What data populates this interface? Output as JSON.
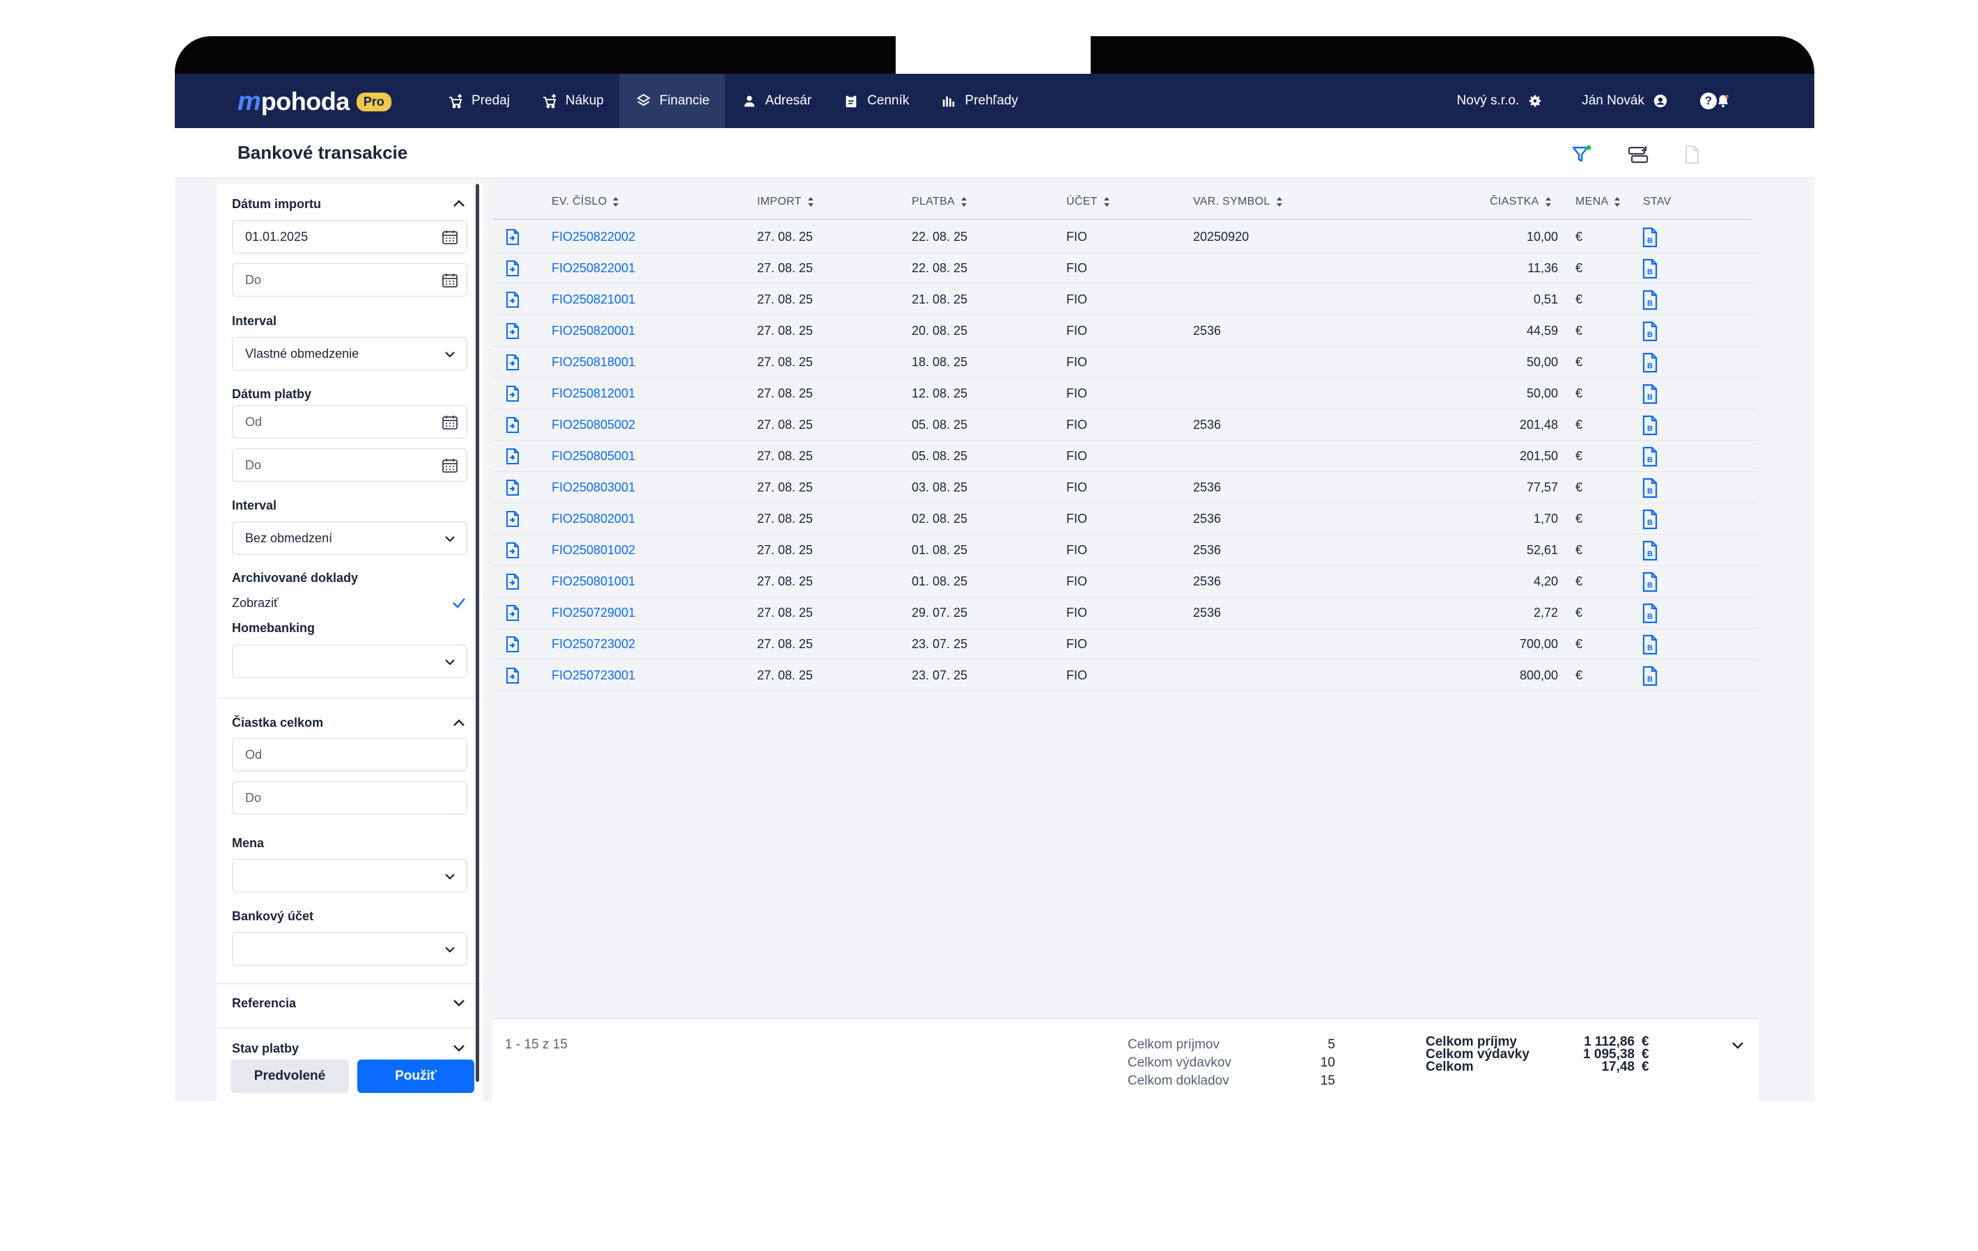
{
  "app": {
    "logo_text": "pohoda",
    "logo_badge": "Pro",
    "nav": [
      {
        "label": "Predaj",
        "icon": "cart-plus-icon"
      },
      {
        "label": "Nákup",
        "icon": "cart-plus-icon"
      },
      {
        "label": "Financie",
        "icon": "coins-icon",
        "active": true
      },
      {
        "label": "Adresár",
        "icon": "person-icon"
      },
      {
        "label": "Cenník",
        "icon": "clipboard-icon"
      },
      {
        "label": "Prehľady",
        "icon": "bar-chart-icon"
      }
    ],
    "company": "Nový s.r.o.",
    "user": "Ján Novák",
    "help_label": "?"
  },
  "page": {
    "title": "Bankové transakcie"
  },
  "filters": {
    "datum_importu": {
      "label": "Dátum importu",
      "from_value": "01.01.2025",
      "to_placeholder": "Do"
    },
    "interval1": {
      "label": "Interval",
      "value": "Vlastné obmedzenie"
    },
    "datum_platby": {
      "label": "Dátum platby",
      "from_placeholder": "Od",
      "to_placeholder": "Do"
    },
    "interval2": {
      "label": "Interval",
      "value": "Bez obmedzení"
    },
    "archivovane": {
      "label": "Archivované doklady",
      "option": "Zobraziť",
      "checked": true
    },
    "homebanking": {
      "label": "Homebanking",
      "value": ""
    },
    "ciastka": {
      "label": "Čiastka celkom",
      "from_placeholder": "Od",
      "to_placeholder": "Do"
    },
    "mena": {
      "label": "Mena",
      "value": ""
    },
    "bankovy_ucet": {
      "label": "Bankový účet",
      "value": ""
    },
    "referencia": {
      "label": "Referencia"
    },
    "stav_platby": {
      "label": "Stav platby"
    },
    "btn_default": "Predvolené",
    "btn_apply": "Použiť"
  },
  "table": {
    "columns": {
      "ev_cislo": "EV. ČÍSLO",
      "import": "IMPORT",
      "platba": "PLATBA",
      "ucet": "ÚČET",
      "var_symbol": "VAR. SYMBOL",
      "ciastka": "ČIASTKA",
      "mena": "MENA",
      "stav": "STAV"
    },
    "rows": [
      {
        "ev": "FIO250822002",
        "import": "27. 08. 25",
        "platba": "22. 08. 25",
        "ucet": "FIO",
        "vs": "20250920",
        "ciastka": "10,00",
        "mena": "€"
      },
      {
        "ev": "FIO250822001",
        "import": "27. 08. 25",
        "platba": "22. 08. 25",
        "ucet": "FIO",
        "vs": "",
        "ciastka": "11,36",
        "mena": "€"
      },
      {
        "ev": "FIO250821001",
        "import": "27. 08. 25",
        "platba": "21. 08. 25",
        "ucet": "FIO",
        "vs": "",
        "ciastka": "0,51",
        "mena": "€"
      },
      {
        "ev": "FIO250820001",
        "import": "27. 08. 25",
        "platba": "20. 08. 25",
        "ucet": "FIO",
        "vs": "2536",
        "ciastka": "44,59",
        "mena": "€"
      },
      {
        "ev": "FIO250818001",
        "import": "27. 08. 25",
        "platba": "18. 08. 25",
        "ucet": "FIO",
        "vs": "",
        "ciastka": "50,00",
        "mena": "€"
      },
      {
        "ev": "FIO250812001",
        "import": "27. 08. 25",
        "platba": "12. 08. 25",
        "ucet": "FIO",
        "vs": "",
        "ciastka": "50,00",
        "mena": "€"
      },
      {
        "ev": "FIO250805002",
        "import": "27. 08. 25",
        "platba": "05. 08. 25",
        "ucet": "FIO",
        "vs": "2536",
        "ciastka": "201,48",
        "mena": "€"
      },
      {
        "ev": "FIO250805001",
        "import": "27. 08. 25",
        "platba": "05. 08. 25",
        "ucet": "FIO",
        "vs": "",
        "ciastka": "201,50",
        "mena": "€"
      },
      {
        "ev": "FIO250803001",
        "import": "27. 08. 25",
        "platba": "03. 08. 25",
        "ucet": "FIO",
        "vs": "2536",
        "ciastka": "77,57",
        "mena": "€"
      },
      {
        "ev": "FIO250802001",
        "import": "27. 08. 25",
        "platba": "02. 08. 25",
        "ucet": "FIO",
        "vs": "2536",
        "ciastka": "1,70",
        "mena": "€"
      },
      {
        "ev": "FIO250801002",
        "import": "27. 08. 25",
        "platba": "01. 08. 25",
        "ucet": "FIO",
        "vs": "2536",
        "ciastka": "52,61",
        "mena": "€"
      },
      {
        "ev": "FIO250801001",
        "import": "27. 08. 25",
        "platba": "01. 08. 25",
        "ucet": "FIO",
        "vs": "2536",
        "ciastka": "4,20",
        "mena": "€"
      },
      {
        "ev": "FIO250729001",
        "import": "27. 08. 25",
        "platba": "29. 07. 25",
        "ucet": "FIO",
        "vs": "2536",
        "ciastka": "2,72",
        "mena": "€"
      },
      {
        "ev": "FIO250723002",
        "import": "27. 08. 25",
        "platba": "23. 07. 25",
        "ucet": "FIO",
        "vs": "",
        "ciastka": "700,00",
        "mena": "€"
      },
      {
        "ev": "FIO250723001",
        "import": "27. 08. 25",
        "platba": "23. 07. 25",
        "ucet": "FIO",
        "vs": "",
        "ciastka": "800,00",
        "mena": "€"
      }
    ]
  },
  "footer": {
    "pagination": "1 - 15 z 15",
    "counts": [
      {
        "label": "Celkom príjmov",
        "value": "5"
      },
      {
        "label": "Celkom výdavkov",
        "value": "10"
      },
      {
        "label": "Celkom dokladov",
        "value": "15"
      }
    ],
    "sums": [
      {
        "label": "Celkom príjmy",
        "value": "1 112,86",
        "currency": "€"
      },
      {
        "label": "Celkom výdavky",
        "value": "1 095,38",
        "currency": "€"
      },
      {
        "label": "Celkom",
        "value": "17,48",
        "currency": "€"
      }
    ]
  },
  "colors": {
    "nav_bg": "#172452",
    "accent": "#0a6cff",
    "badge": "#f2c94c"
  }
}
